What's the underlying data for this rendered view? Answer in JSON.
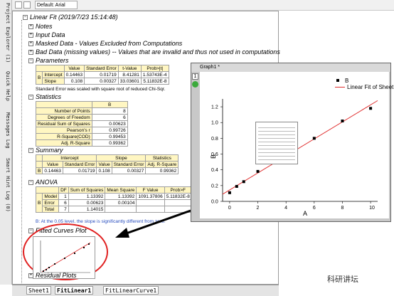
{
  "toolbar": {
    "font_name": "Default: Arial"
  },
  "left_tabs": [
    "Project Explorer (1)",
    "Quick Help",
    "Messages Log",
    "Smart Hint Log (0)"
  ],
  "report": {
    "title": "Linear Fit (2019/7/23 15:14:48)",
    "nodes": [
      "Notes",
      "Input Data",
      "Masked Data - Values Excluded from Computations",
      "Bad Data (missing values) -- Values that are invalid and thus not used in computations"
    ],
    "parameters": {
      "label": "Parameters",
      "headers": [
        "Value",
        "Standard Error",
        "t-Value",
        "Prob>|t|"
      ],
      "group": "B",
      "rows": [
        {
          "name": "Intercept",
          "cells": [
            "0.14463",
            "0.01719",
            "8.41281",
            "1.53743E-4"
          ]
        },
        {
          "name": "Slope",
          "cells": [
            "0.108",
            "0.00327",
            "33.03601",
            "5.11832E-8"
          ]
        }
      ],
      "note": "Standard Error was scaled with square root of reduced Chi-Sqr."
    },
    "statistics": {
      "label": "Statistics",
      "header": "B",
      "rows": [
        [
          "Number of Points",
          "8"
        ],
        [
          "Degrees of Freedom",
          "6"
        ],
        [
          "Residual Sum of Squares",
          "0.00623"
        ],
        [
          "Pearson's r",
          "0.99726"
        ],
        [
          "R-Square(COD)",
          "0.99453"
        ],
        [
          "Adj. R-Square",
          "0.99362"
        ]
      ]
    },
    "summary": {
      "label": "Summary",
      "groups": [
        "Intercept",
        "Slope",
        "Statistics"
      ],
      "headers": [
        "Value",
        "Standard Error",
        "Value",
        "Standard Error",
        "Adj. R-Square"
      ],
      "row_label": "B",
      "cells": [
        "0.14463",
        "0.01719",
        "0.108",
        "0.00327",
        "0.99362"
      ]
    },
    "anova": {
      "label": "ANOVA",
      "headers": [
        "DF",
        "Sum of Squares",
        "Mean Square",
        "F Value",
        "Prob>F"
      ],
      "group": "B",
      "rows": [
        {
          "name": "Model",
          "cells": [
            "1",
            "1.13392",
            "1.13392",
            "1091.37806",
            "5.11832E-8"
          ]
        },
        {
          "name": "Error",
          "cells": [
            "6",
            "0.00623",
            "0.00104",
            "",
            ""
          ]
        },
        {
          "name": "Total",
          "cells": [
            "7",
            "1.14015",
            "",
            "",
            ""
          ]
        }
      ],
      "note": "B: At the 0.05 level, the slope is significantly different from zero."
    },
    "fitted_curves": {
      "label": "Fitted Curves Plot"
    },
    "residual": {
      "label": "Residual Plots"
    }
  },
  "sheet_tabs": [
    "Sheet1",
    "FitLinear1",
    "FitLinearCurve1"
  ],
  "graph": {
    "title": "Graph1 *",
    "layer_number": "1",
    "legend": [
      "B",
      "Linear Fit of Sheet"
    ],
    "xlabel": "A",
    "ylabel": "B",
    "colors": {
      "points": "#000000",
      "fit_line": "#e03030"
    }
  },
  "chart_data": {
    "type": "scatter",
    "x_ticks": [
      "0",
      "2",
      "4",
      "6",
      "8",
      "10"
    ],
    "y_ticks": [
      "0.0",
      "0.2",
      "0.4",
      "0.6",
      "0.8",
      "1.0",
      "1.2"
    ],
    "xlim": [
      -0.5,
      10.5
    ],
    "ylim": [
      0,
      1.3
    ],
    "series": [
      {
        "name": "B",
        "x": [
          0,
          0.5,
          1,
          2,
          4,
          6,
          8,
          10
        ],
        "y": [
          0.11,
          0.19,
          0.25,
          0.38,
          0.6,
          0.8,
          1.02,
          1.18
        ]
      },
      {
        "name": "Linear Fit of Sheet",
        "x": [
          -0.5,
          10.5
        ],
        "y": [
          0.09063,
          1.27863
        ]
      }
    ]
  },
  "watermark": "科研讲坛"
}
